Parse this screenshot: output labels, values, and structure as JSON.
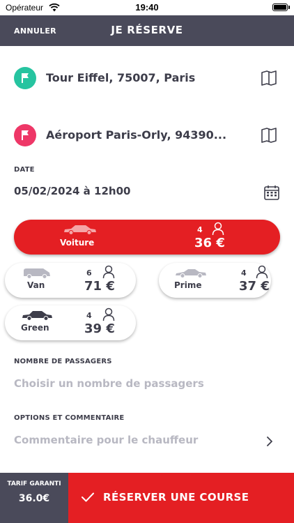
{
  "status_bar": {
    "carrier": "Opérateur",
    "time": "19:40"
  },
  "nav": {
    "cancel_label": "ANNULER",
    "title": "JE RÉSERVE"
  },
  "pickup": {
    "address": "Tour Eiffel, 75007, Paris"
  },
  "dropoff": {
    "address": "Aéroport Paris-Orly, 94390..."
  },
  "date": {
    "label": "DATE",
    "value": "05/02/2024 à 12h00"
  },
  "vehicles": [
    {
      "name": "Voiture",
      "seats": "4",
      "price": "36 €",
      "selected": true
    },
    {
      "name": "Van",
      "seats": "6",
      "price": "71 €",
      "selected": false
    },
    {
      "name": "Prime",
      "seats": "4",
      "price": "37 €",
      "selected": false
    },
    {
      "name": "Green",
      "seats": "4",
      "price": "39 €",
      "selected": false
    }
  ],
  "passengers": {
    "label": "NOMBRE DE PASSAGERS",
    "placeholder": "Choisir un nombre de passagers"
  },
  "options": {
    "label": "OPTIONS ET COMMENTAIRE",
    "placeholder": "Commentaire pour le chauffeur"
  },
  "footer": {
    "tarif_label": "TARIF GARANTI",
    "tarif_value": "36.0€",
    "reserve_label": "RÉSERVER UNE COURSE"
  },
  "colors": {
    "primary_red": "#e41f23",
    "dark_gray": "#4a4a5a",
    "pickup_green": "#26c4a0",
    "dropoff_pink": "#ee3767"
  }
}
